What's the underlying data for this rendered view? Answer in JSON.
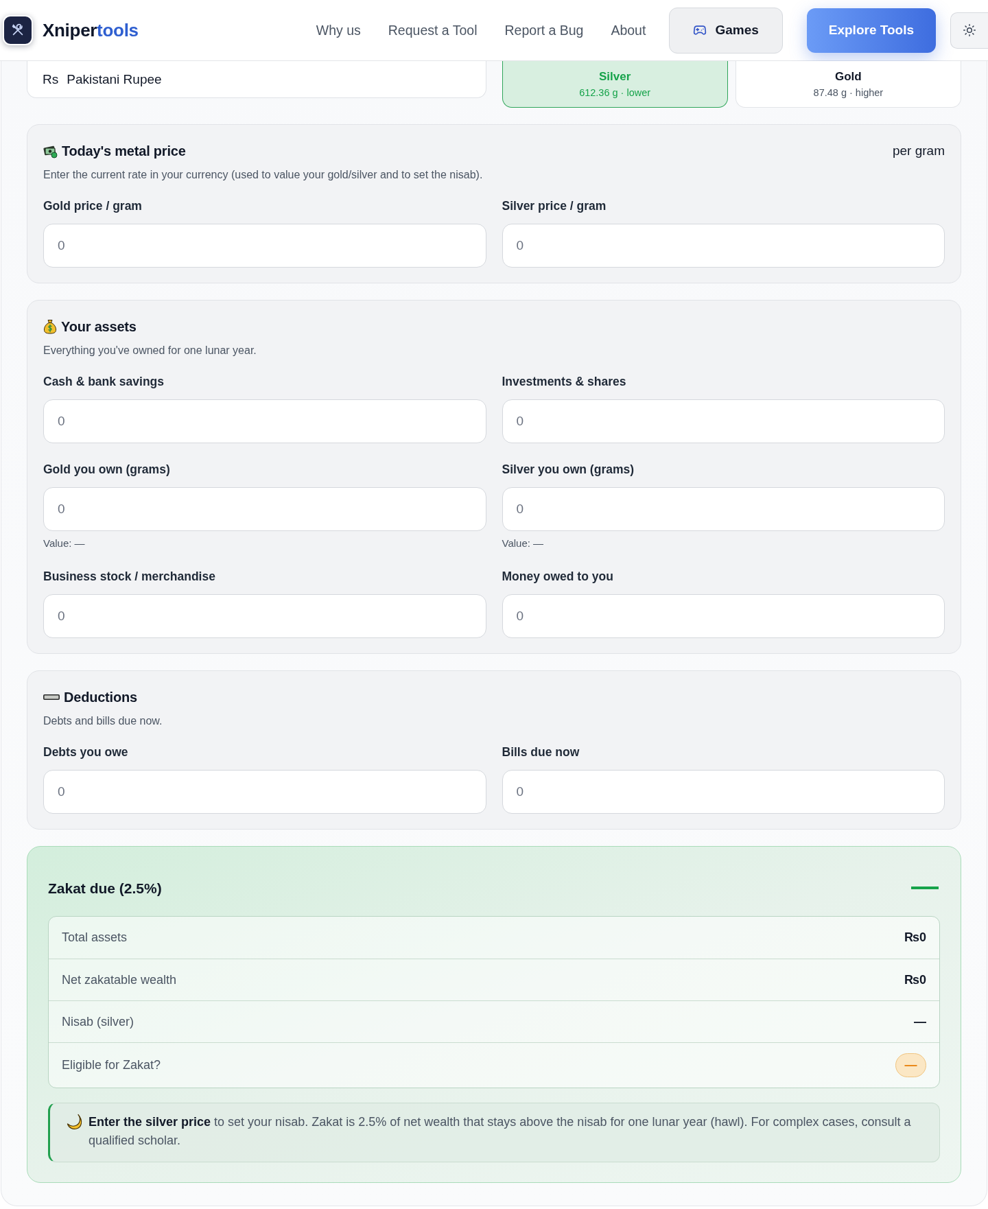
{
  "header": {
    "brand": {
      "text": "Xniper",
      "highlight": "tools"
    },
    "nav": [
      "Why us",
      "Request a Tool",
      "Report a Bug",
      "About"
    ],
    "games_button": "Games",
    "cta_button": "Explore Tools"
  },
  "currency_select": {
    "symbol": "Rs",
    "name": "Pakistani Rupee"
  },
  "nisab_options": [
    {
      "label": "Silver",
      "detail": "612.36 g · lower",
      "selected": true
    },
    {
      "label": "Gold",
      "detail": "87.48 g · higher",
      "selected": false
    }
  ],
  "sections": [
    {
      "kind": "metal",
      "title": "Today's metal price",
      "aside": "per gram",
      "subtitle": "Enter the current rate in your currency (used to value your gold/silver and to set the nisab).",
      "fields": [
        {
          "label": "Gold price / gram",
          "placeholder": "0"
        },
        {
          "label": "Silver price / gram",
          "placeholder": "0"
        }
      ]
    },
    {
      "kind": "assets",
      "title": "Your assets",
      "subtitle": "Everything you've owned for one lunar year.",
      "fields": [
        {
          "label": "Cash & bank savings",
          "placeholder": "0"
        },
        {
          "label": "Investments & shares",
          "placeholder": "0"
        },
        {
          "label": "Gold you own (grams)",
          "placeholder": "0",
          "note": "Value: —"
        },
        {
          "label": "Silver you own (grams)",
          "placeholder": "0",
          "note": "Value: —"
        },
        {
          "label": "Business stock / merchandise",
          "placeholder": "0"
        },
        {
          "label": "Money owed to you",
          "placeholder": "0"
        }
      ]
    },
    {
      "kind": "deductions",
      "title": "Deductions",
      "subtitle": "Debts and bills due now.",
      "fields": [
        {
          "label": "Debts you owe",
          "placeholder": "0"
        },
        {
          "label": "Bills due now",
          "placeholder": "0"
        }
      ]
    }
  ],
  "result": {
    "title": "Zakat due (2.5%)",
    "amount": "—",
    "rows": [
      {
        "kind": "amount",
        "label": "Total assets",
        "value": "₨0"
      },
      {
        "kind": "amount",
        "label": "Net zakatable wealth",
        "value": "₨0"
      },
      {
        "kind": "amount",
        "label": "Nisab (silver)",
        "value": "—"
      },
      {
        "kind": "badge",
        "label": "Eligible for Zakat?",
        "value": "—"
      }
    ],
    "note": "**Enter the silver price** to set your nisab. Zakat is 2.5% of net wealth that stays above the nisab for one lunar year (hawl). For complex cases, consult a qualified scholar."
  }
}
